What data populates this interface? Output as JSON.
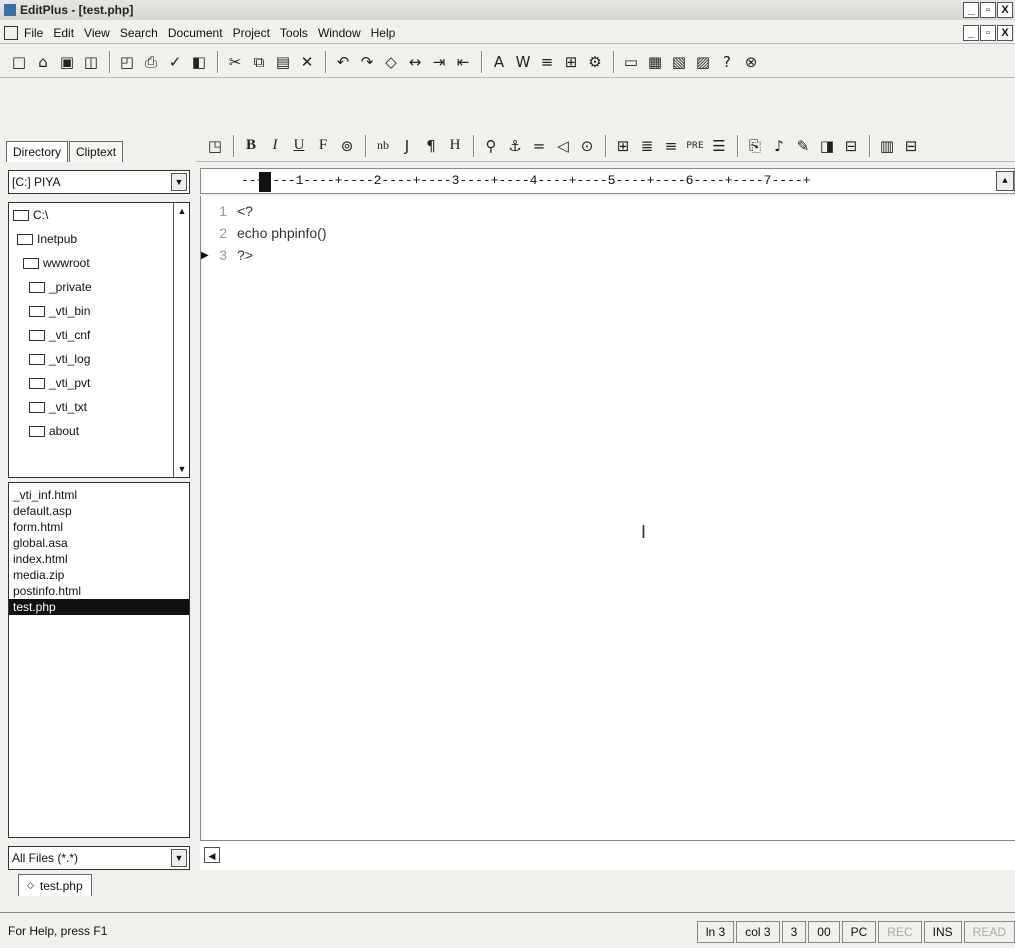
{
  "window": {
    "title": "EditPlus - [test.php]",
    "controls": [
      "_",
      "▫",
      "X"
    ]
  },
  "menu": {
    "items": [
      "File",
      "Edit",
      "View",
      "Search",
      "Document",
      "Project",
      "Tools",
      "Window",
      "Help"
    ]
  },
  "left_panel": {
    "tabs": [
      "Directory",
      "Cliptext"
    ],
    "drive": "[C:] PIYA",
    "tree": [
      "C:\\",
      "Inetpub",
      "wwwroot",
      "_private",
      "_vti_bin",
      "_vti_cnf",
      "_vti_log",
      "_vti_pvt",
      "_vti_txt",
      "about"
    ],
    "files": [
      "_vti_inf.html",
      "default.asp",
      "form.html",
      "global.asa",
      "index.html",
      "media.zip",
      "postinfo.html",
      "test.php"
    ],
    "selected_file": "test.php",
    "filter": "All Files (*.*)"
  },
  "toolbar2": {
    "items": [
      "B",
      "I",
      "U",
      "F",
      "nb",
      "J",
      "¶",
      "H",
      "=",
      "PRE"
    ]
  },
  "ruler": {
    "text": "--+----1----+----2----+----3----+----4----+----5----+----6----+----7----+"
  },
  "editor": {
    "lines": [
      {
        "num": "1",
        "text": "<?"
      },
      {
        "num": "2",
        "text": "echo phpinfo()"
      },
      {
        "num": "3",
        "text": "?>"
      }
    ]
  },
  "doc_tab": {
    "label": "test.php"
  },
  "status": {
    "help": "For Help, press F1",
    "ln": "ln 3",
    "col": "col 3",
    "sel": "3",
    "code": "00",
    "mode": "PC",
    "rec": "REC",
    "ins": "INS",
    "read": "READ"
  }
}
